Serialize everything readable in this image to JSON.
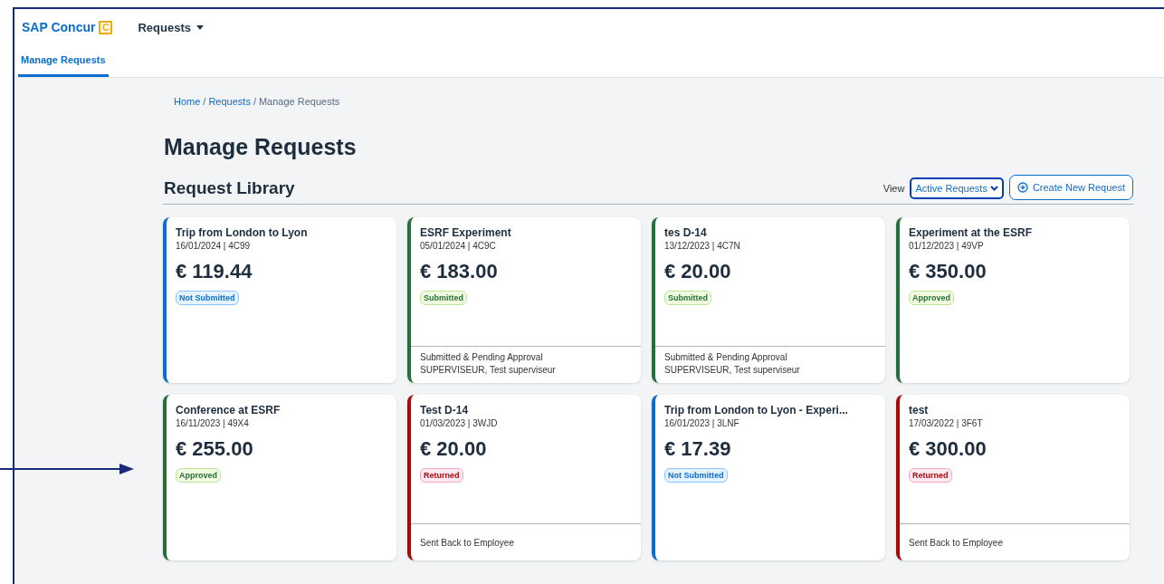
{
  "header": {
    "logo": "SAP Concur",
    "logo_mark": "C",
    "menu": "Requests"
  },
  "tabs": [
    {
      "label": "Manage Requests",
      "selected": true
    }
  ],
  "breadcrumb": {
    "separator": "/",
    "items": [
      {
        "label": "Home",
        "link": true
      },
      {
        "label": "Requests",
        "link": true
      },
      {
        "label": "Manage Requests",
        "link": false
      }
    ]
  },
  "title": "Manage Requests",
  "section_title": "Request Library",
  "view": {
    "label": "View",
    "value": "Active Requests"
  },
  "create_button": "Create New Request",
  "requests": [
    {
      "title": "Trip from London to Lyon",
      "meta": "16/01/2024 | 4C99",
      "amount": "€ 119.44",
      "status": "Not Submitted",
      "kind": "draft"
    },
    {
      "title": "ESRF Experiment",
      "meta": "05/01/2024 | 4C9C",
      "amount": "€ 183.00",
      "status": "Submitted",
      "kind": "ok",
      "footer": [
        "Submitted & Pending Approval",
        "SUPERVISEUR, Test superviseur"
      ]
    },
    {
      "title": "tes D-14",
      "meta": "13/12/2023 | 4C7N",
      "amount": "€ 20.00",
      "status": "Submitted",
      "kind": "ok",
      "footer": [
        "Submitted & Pending Approval",
        "SUPERVISEUR, Test superviseur"
      ]
    },
    {
      "title": "Experiment at the ESRF",
      "meta": "01/12/2023 | 49VP",
      "amount": "€ 350.00",
      "status": "Approved",
      "kind": "ok"
    },
    {
      "title": "Conference at ESRF",
      "meta": "16/11/2023 | 49X4",
      "amount": "€ 255.00",
      "status": "Approved",
      "kind": "ok"
    },
    {
      "title": "Test D-14",
      "meta": "01/03/2023 | 3WJD",
      "amount": "€ 20.00",
      "status": "Returned",
      "kind": "returned",
      "footer": [
        "Sent Back to Employee"
      ]
    },
    {
      "title": "Trip from London to Lyon - Experi...",
      "meta": "16/01/2023 | 3LNF",
      "amount": "€ 17.39",
      "status": "Not Submitted",
      "kind": "draft"
    },
    {
      "title": "test",
      "meta": "17/03/2022 | 3F6T",
      "amount": "€ 300.00",
      "status": "Returned",
      "kind": "returned",
      "footer": [
        "Sent Back to Employee"
      ]
    }
  ]
}
